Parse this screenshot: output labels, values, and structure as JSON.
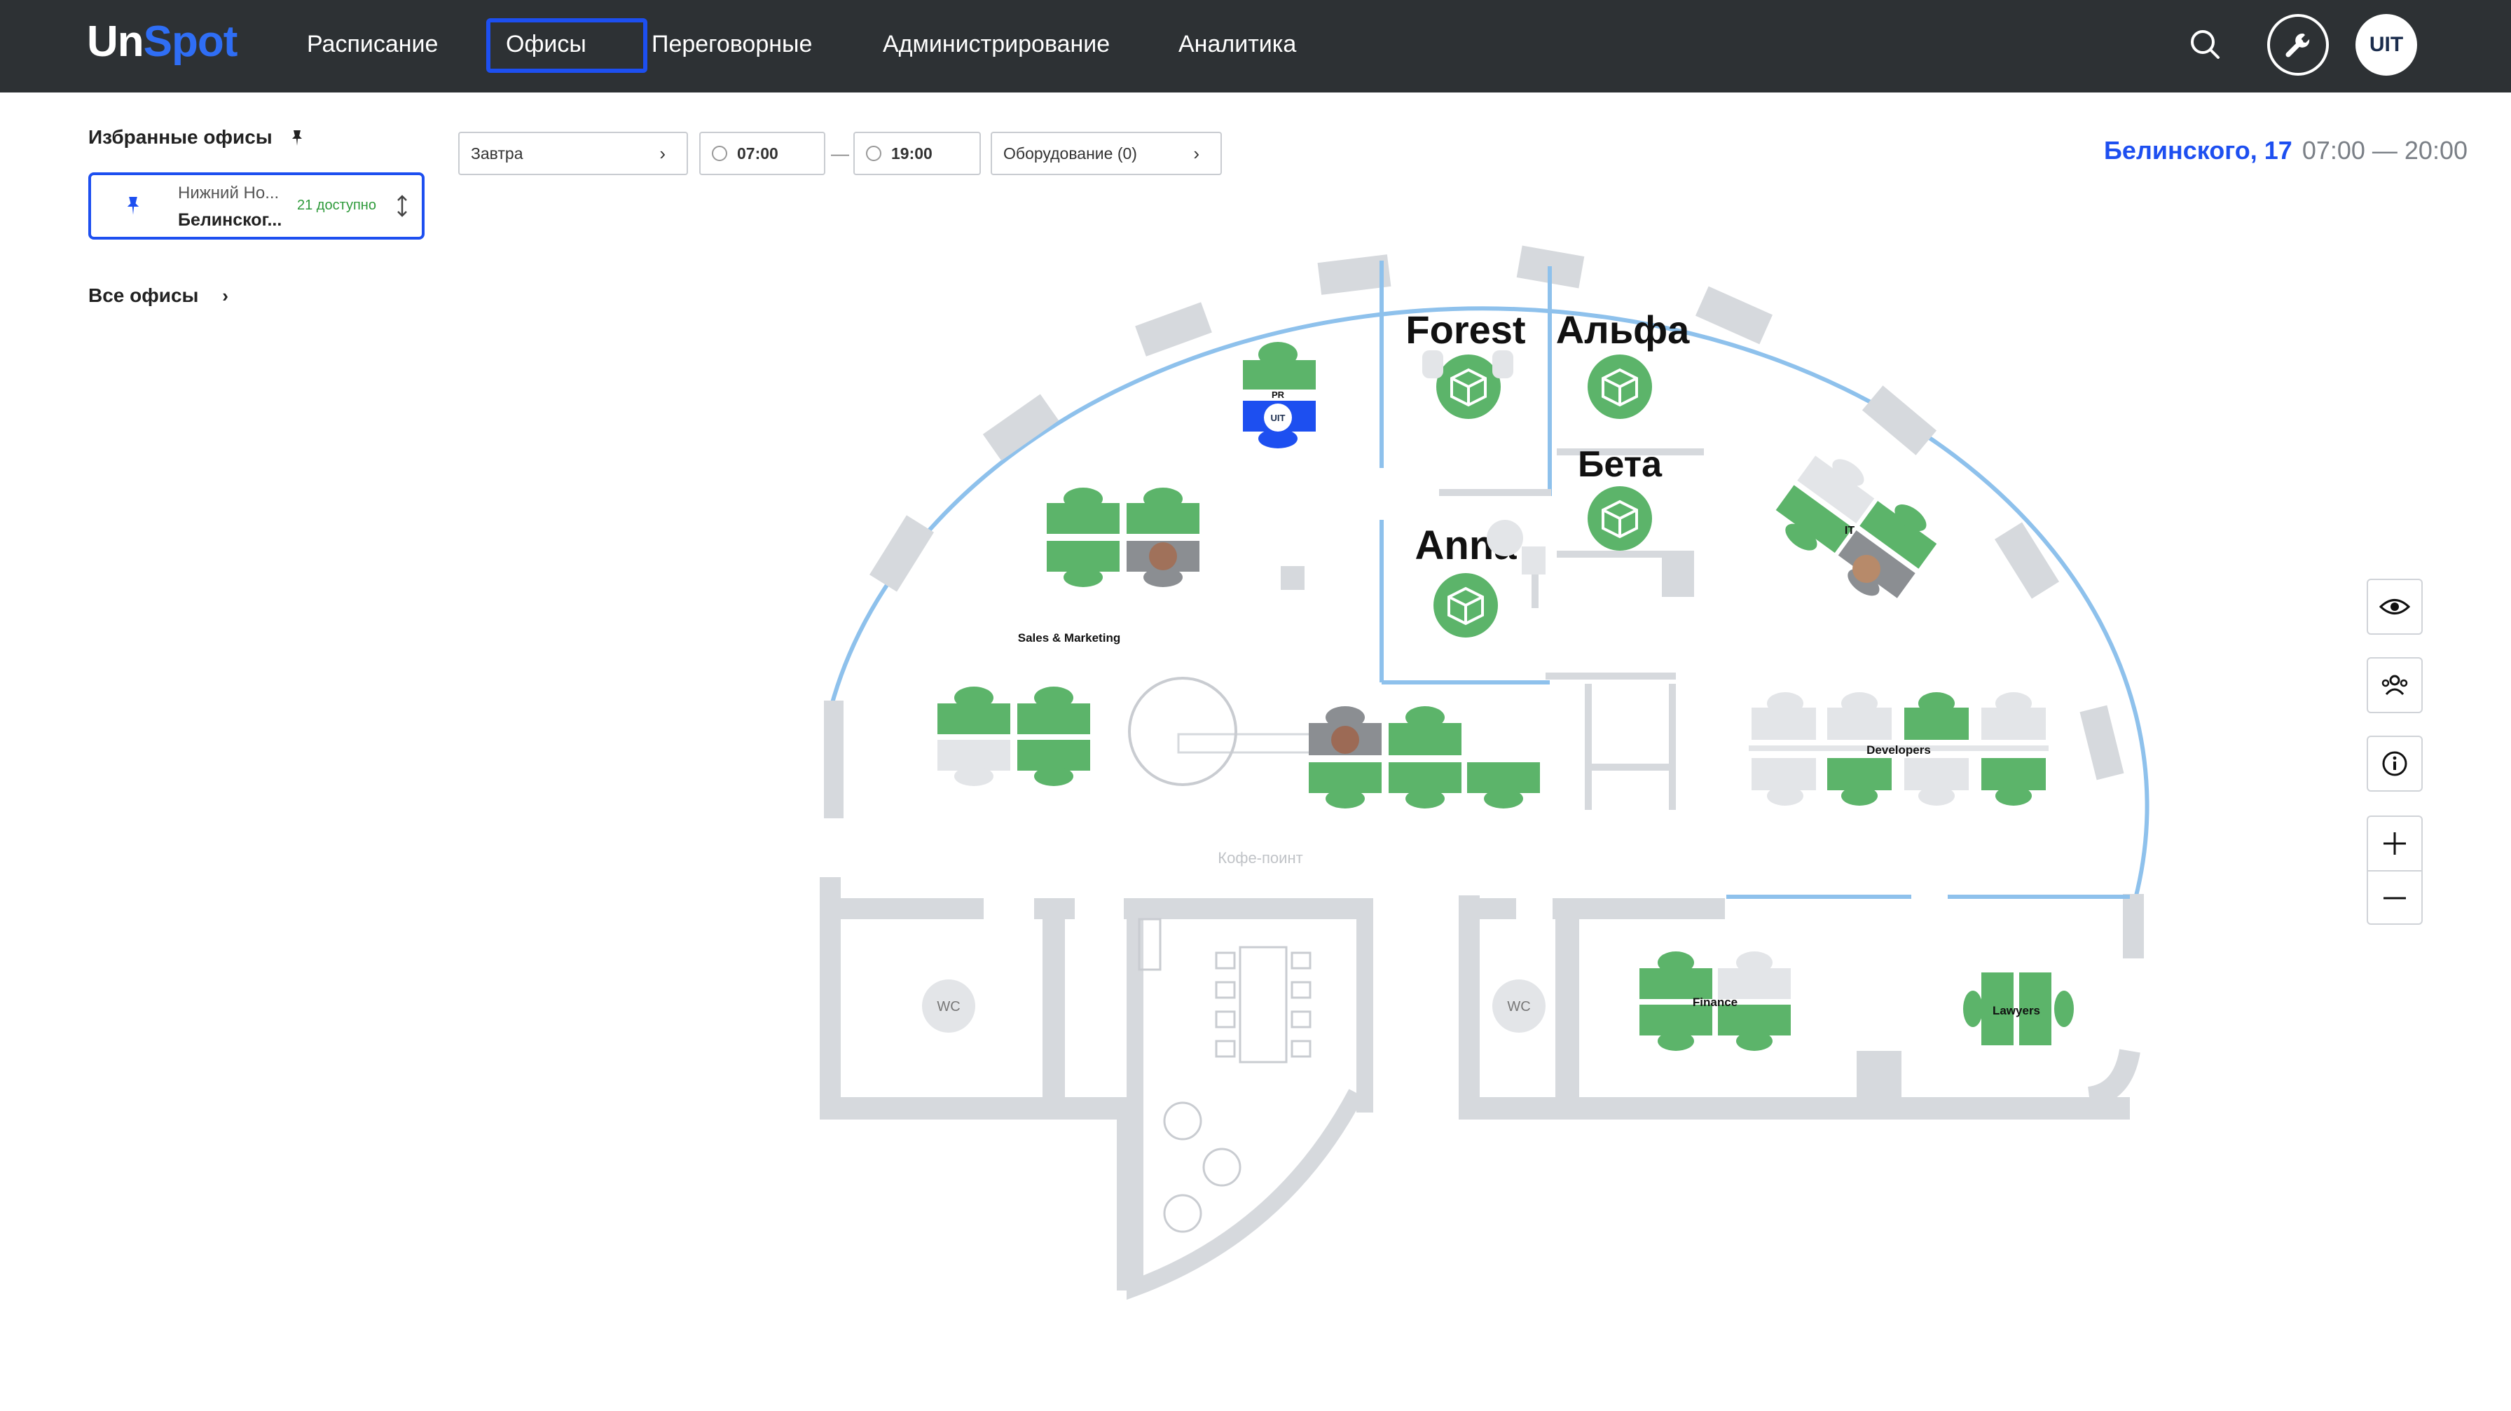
{
  "app": {
    "logo_part1": "Un",
    "logo_part2": "Spot"
  },
  "nav": {
    "items": [
      {
        "label": "Расписание"
      },
      {
        "label": "Офисы",
        "active": true
      },
      {
        "label": "Переговорные"
      },
      {
        "label": "Администрирование"
      },
      {
        "label": "Аналитика"
      }
    ]
  },
  "header_right": {
    "avatar_text": "UIT",
    "icons": [
      "search-icon",
      "wrench-icon"
    ]
  },
  "sidebar": {
    "favorites_title": "Избранные офисы",
    "favorite_card": {
      "city": "Нижний Но...",
      "street": "Белинског...",
      "availability": "21 доступно"
    },
    "all_offices": "Все офисы"
  },
  "filters": {
    "date": "Завтра",
    "time_from": "07:00",
    "time_dash": "—",
    "time_to": "19:00",
    "equipment": "Оборудование (0)"
  },
  "office_header": {
    "name": "Белинского, 17",
    "hours": "07:00 — 20:00"
  },
  "right_tools": [
    "eye-icon",
    "people-icon",
    "info-icon",
    "zoom-in-icon",
    "zoom-out-icon"
  ],
  "map": {
    "rooms": [
      "Forest",
      "Альфа",
      "Бета",
      "Anna"
    ],
    "zones": [
      "PR",
      "Sales & Marketing",
      "IT",
      "Developers",
      "Finance",
      "Lawyers"
    ],
    "labels": {
      "coffee": "Кофе-поинт",
      "wc1": "WC",
      "wc2": "WC",
      "pr_avatar": "UIT"
    }
  },
  "colors": {
    "accent": "#1d4ff0",
    "available": "#5cb46a",
    "unavailable": "#d6d9dd",
    "wall": "#cfd3d7",
    "glass": "#8ec1ec"
  }
}
